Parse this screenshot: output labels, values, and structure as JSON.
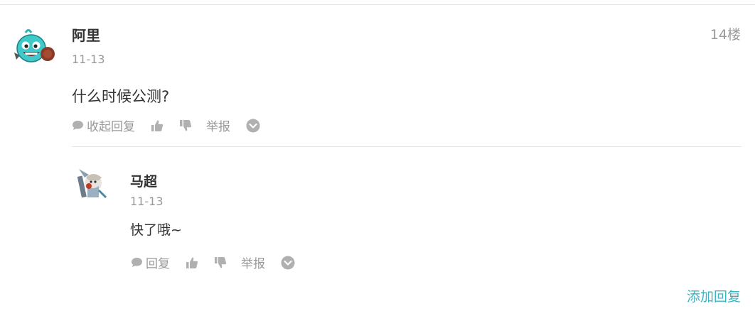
{
  "post": {
    "author": "阿里",
    "floor": "14楼",
    "date": "11-13",
    "content": "什么时候公测?",
    "actions": {
      "collapse_label": "收起回复",
      "report_label": "举报"
    }
  },
  "reply": {
    "author": "马超",
    "date": "11-13",
    "content": "快了哦~",
    "actions": {
      "reply_label": "回复",
      "report_label": "举报"
    }
  },
  "footer": {
    "add_reply_label": "添加回复"
  },
  "colors": {
    "accent": "#3bb4c1",
    "muted_text": "#999999",
    "icon_gray": "#b0b0b0",
    "divider": "#e6e6e6"
  },
  "icons": [
    "comment-icon",
    "thumbs-up-icon",
    "thumbs-down-icon",
    "chevron-down-icon"
  ]
}
